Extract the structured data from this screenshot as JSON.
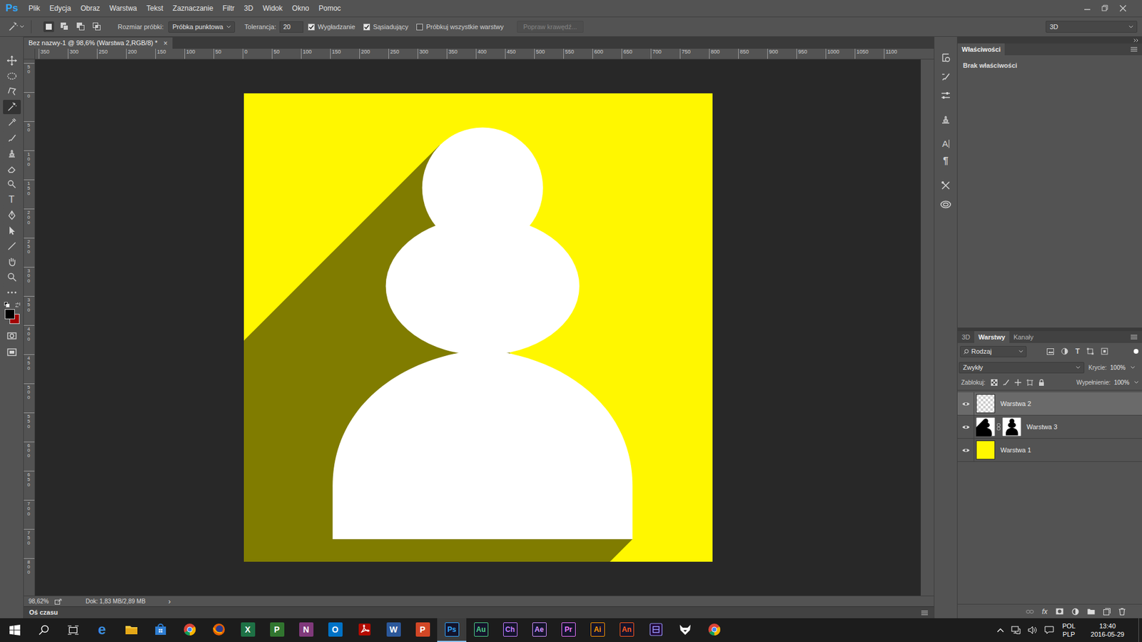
{
  "app": {
    "logo": "Ps"
  },
  "menu": [
    "Plik",
    "Edycja",
    "Obraz",
    "Warstwa",
    "Tekst",
    "Zaznaczanie",
    "Filtr",
    "3D",
    "Widok",
    "Okno",
    "Pomoc"
  ],
  "options_bar": {
    "sample_size_label": "Rozmiar próbki:",
    "sample_size": "Próbka punktowa",
    "tolerance_label": "Tolerancja:",
    "tolerance": "20",
    "checkboxes": [
      {
        "label": "Wygładzanie",
        "checked": true
      },
      {
        "label": "Sąsiadujący",
        "checked": true
      },
      {
        "label": "Próbkuj wszystkie warstwy",
        "checked": false
      }
    ],
    "refine_edge": {
      "label": "Popraw krawędź...",
      "disabled": true
    },
    "workspace": "3D"
  },
  "toolbar": {
    "tools": [
      {
        "kind": "move",
        "selected": false
      },
      {
        "kind": "marquee",
        "selected": false
      },
      {
        "kind": "lasso",
        "selected": false
      },
      {
        "kind": "wand",
        "selected": true
      },
      {
        "kind": "eyedropper",
        "selected": false
      },
      {
        "kind": "brush",
        "selected": false
      },
      {
        "kind": "stamp",
        "selected": false
      },
      {
        "kind": "eraser",
        "selected": false
      },
      {
        "kind": "dodge",
        "selected": false
      },
      {
        "kind": "type",
        "label": "T",
        "selected": false
      },
      {
        "kind": "pen",
        "selected": false
      },
      {
        "kind": "pathselect",
        "selected": false
      },
      {
        "kind": "line",
        "selected": false
      },
      {
        "kind": "hand",
        "selected": false
      },
      {
        "kind": "zoom",
        "selected": false
      },
      {
        "kind": "more",
        "selected": false
      }
    ],
    "swatches": [
      {
        "kind": "foreground",
        "color": "#000000"
      },
      {
        "kind": "background",
        "color": "#a30000"
      }
    ],
    "modes": [
      {
        "kind": "quickmask"
      },
      {
        "kind": "screenmode"
      }
    ]
  },
  "document": {
    "tab_title": "Bez nazwy-1 @ 98,6% (Warstwa 2,RGB/8) *",
    "close": "×"
  },
  "rulers": {
    "horizontal": [
      "350",
      "300",
      "250",
      "200",
      "150",
      "100",
      "50",
      "0",
      "50",
      "100",
      "150",
      "200",
      "250",
      "300",
      "350",
      "400",
      "450",
      "500",
      "550",
      "600",
      "650",
      "700",
      "750",
      "800",
      "850",
      "900",
      "950",
      "1000",
      "1050",
      "1100"
    ],
    "vertical": [
      "50",
      "0",
      "50",
      "100",
      "150",
      "200",
      "250",
      "300",
      "350",
      "400",
      "450",
      "500",
      "550",
      "600",
      "650",
      "700",
      "750",
      "800"
    ]
  },
  "status_bar": {
    "zoom": "98,62%",
    "doc_size": "Dok: 1,83 MB/2,89 MB",
    "more": "›"
  },
  "timeline": {
    "title": "Oś czasu"
  },
  "side_icons": {
    "character": "A",
    "paragraph": "¶"
  },
  "properties": {
    "title": "Właściwości",
    "body": "Brak właściwości"
  },
  "layers_panel": {
    "tabs": [
      {
        "label": "3D",
        "selected": false
      },
      {
        "label": "Warstwy",
        "selected": true
      },
      {
        "label": "Kanały",
        "selected": false
      }
    ],
    "filter": "Rodzaj",
    "filter_type_glyph": "T",
    "blend_mode": "Zwykły",
    "opacity_label": "Krycie:",
    "opacity": "100%",
    "lock_label": "Zablokuj:",
    "fill_label": "Wypełnienie:",
    "fill": "100%",
    "layers": [
      {
        "name": "Warstwa 2",
        "visible": true,
        "selected": true,
        "kind": "transparent"
      },
      {
        "name": "Warstwa 3",
        "visible": true,
        "selected": false,
        "kind": "masked"
      },
      {
        "name": "Warstwa 1",
        "visible": true,
        "selected": false,
        "kind": "fill",
        "color": "#fff700"
      }
    ],
    "footer_fx": "fx"
  },
  "taskbar": {
    "apps": [
      {
        "kind": "glyph",
        "label": "e",
        "color": "#3b8de0",
        "selected": false
      },
      {
        "kind": "explorer",
        "selected": false
      },
      {
        "kind": "store",
        "selected": false
      },
      {
        "kind": "chrome",
        "selected": false
      },
      {
        "kind": "firefox",
        "selected": false
      },
      {
        "kind": "letter",
        "label": "X",
        "color": "#1e7145",
        "selected": false
      },
      {
        "kind": "letter",
        "label": "P",
        "color": "#31752f",
        "selected": false
      },
      {
        "kind": "letter",
        "label": "N",
        "color": "#80397b",
        "selected": false
      },
      {
        "kind": "letter",
        "label": "O",
        "color": "#0072c6",
        "selected": false
      },
      {
        "kind": "acrobat",
        "selected": false
      },
      {
        "kind": "letter",
        "label": "W",
        "color": "#2b579a",
        "selected": false
      },
      {
        "kind": "letter",
        "label": "P",
        "color": "#d24726",
        "selected": false
      },
      {
        "kind": "adobe",
        "label": "Ps",
        "color": "#31a8ff",
        "selected": true
      },
      {
        "kind": "adobe",
        "label": "Au",
        "color": "#4fd187",
        "selected": false
      },
      {
        "kind": "adobe",
        "label": "Ch",
        "color": "#c77dff",
        "selected": false
      },
      {
        "kind": "adobe",
        "label": "Ae",
        "color": "#d291ff",
        "selected": false
      },
      {
        "kind": "adobe",
        "label": "Pr",
        "color": "#ea77ff",
        "selected": false
      },
      {
        "kind": "adobe",
        "label": "Ai",
        "color": "#ff9a00",
        "selected": false
      },
      {
        "kind": "adobe",
        "label": "An",
        "color": "#ff5a1f",
        "selected": false
      },
      {
        "kind": "encoder",
        "selected": false
      },
      {
        "kind": "fox",
        "selected": false
      },
      {
        "kind": "chrome",
        "selected": false
      }
    ],
    "language": "POL",
    "layout": "PLP",
    "time": "13:40",
    "date": "2016-05-29"
  }
}
